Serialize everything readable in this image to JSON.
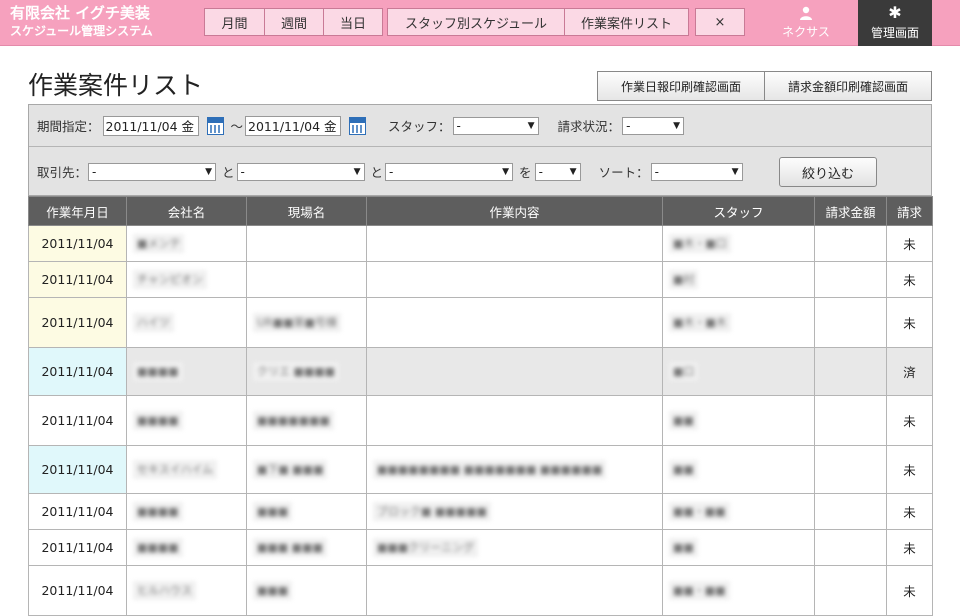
{
  "header": {
    "company": "有限会社 イグチ美装",
    "system": "スケジュール管理システム",
    "nav": [
      "月間",
      "週間",
      "当日",
      "スタッフ別スケジュール",
      "作業案件リスト",
      "×"
    ],
    "user_label": "ネクサス",
    "admin_label": "管理画面",
    "user_icon": "user-icon",
    "admin_icon": "gear-icon",
    "colors": {
      "header_bg": "#f6a1be",
      "admin_bg": "#3a3a3a"
    }
  },
  "page": {
    "title": "作業案件リスト",
    "buttons": {
      "daily_report_print": "作業日報印刷確認画面",
      "invoice_print": "請求金額印刷確認画面"
    }
  },
  "filters": {
    "period_label": "期間指定：",
    "date_from": "2011/11/04 金",
    "tilde": "～",
    "date_to": "2011/11/04 金",
    "staff_label": "スタッフ：",
    "staff_value": "-",
    "billing_status_label": "請求状況：",
    "billing_status_value": "-",
    "client_label": "取引先：",
    "client_values": [
      "-",
      "-",
      "-"
    ],
    "and_1": "と",
    "and_2": "と",
    "wo": "を",
    "wo_value": "-",
    "sort_label": "ソート：",
    "sort_value": "-",
    "submit_label": "絞り込む"
  },
  "table": {
    "columns": [
      "作業年月日",
      "会社名",
      "現場名",
      "作業内容",
      "スタッフ",
      "請求金額",
      "請求"
    ],
    "rows": [
      {
        "date": "2011/11/04",
        "date_color": "yellow",
        "gray": false,
        "company": "■メンテ",
        "site": "",
        "work": "",
        "staff": "■木・■口",
        "amount": "",
        "status": "未"
      },
      {
        "date": "2011/11/04",
        "date_color": "yellow",
        "gray": false,
        "company": "チャンピオン",
        "site": "",
        "work": "",
        "staff": "■村",
        "amount": "",
        "status": "未"
      },
      {
        "date": "2011/11/04",
        "date_color": "yellow",
        "gray": false,
        "company": "ハイツ",
        "site": "UR■■第■号棟",
        "work": "",
        "staff": "■木・■木",
        "amount": "",
        "status": "未"
      },
      {
        "date": "2011/11/04",
        "date_color": "cyan",
        "gray": true,
        "company": "■■■■",
        "site": "クリエ ■■■■",
        "work": "",
        "staff": "■口",
        "amount": "",
        "status": "済"
      },
      {
        "date": "2011/11/04",
        "date_color": "none",
        "gray": false,
        "company": "■■■■",
        "site": "■■■■■■■",
        "work": "",
        "staff": "■■",
        "amount": "",
        "status": "未"
      },
      {
        "date": "2011/11/04",
        "date_color": "cyan",
        "gray": false,
        "company": "セキスイハイム",
        "site": "■下■ ■■■",
        "work": "■■■■■■■■ ■■■■■■■ ■■■■■■",
        "staff": "■■",
        "amount": "",
        "status": "未"
      },
      {
        "date": "2011/11/04",
        "date_color": "none",
        "gray": false,
        "company": "■■■■",
        "site": "■■■",
        "work": "ブロック■ ■■■■■",
        "staff": "■■・■■",
        "amount": "",
        "status": "未"
      },
      {
        "date": "2011/11/04",
        "date_color": "none",
        "gray": false,
        "company": "■■■■",
        "site": "■■■ ■■■",
        "work": "■■■クリーニング",
        "staff": "■■",
        "amount": "",
        "status": "未"
      },
      {
        "date": "2011/11/04",
        "date_color": "none",
        "gray": false,
        "company": "ヒルハウス",
        "site": "■■■",
        "work": "",
        "staff": "■■・■■",
        "amount": "",
        "status": "未"
      }
    ]
  }
}
